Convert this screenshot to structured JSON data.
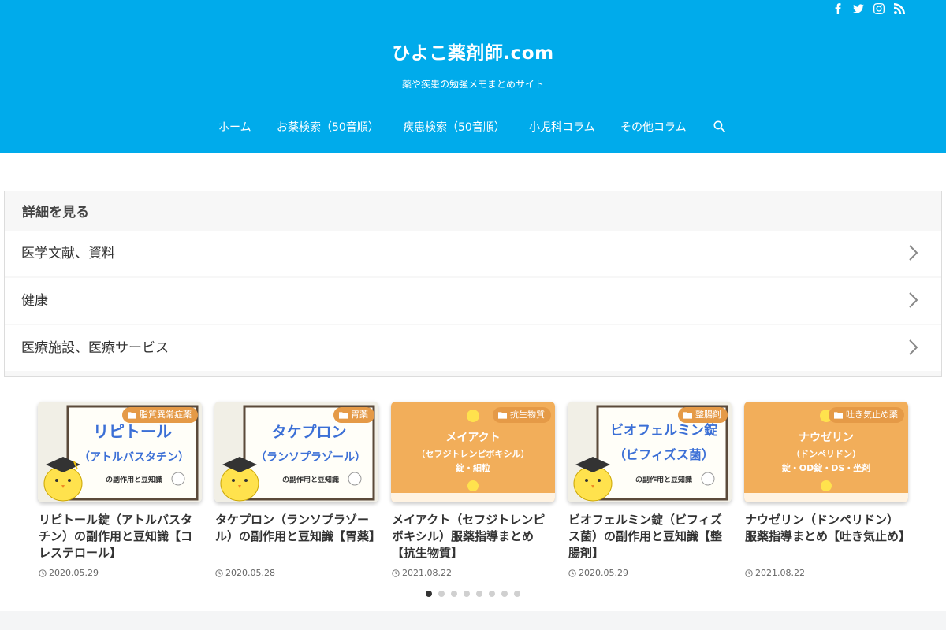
{
  "site": {
    "title": "ひよこ薬剤師.com",
    "description": "薬や疾患の勉強メモまとめサイト",
    "accent_color": "#00abeb",
    "social_icons": [
      "facebook-icon",
      "twitter-icon",
      "instagram-icon",
      "rss-icon"
    ]
  },
  "nav": {
    "items": [
      "ホーム",
      "お薬検索（50音順）",
      "疾患検索（50音順）",
      "小児科コラム",
      "その他コラム"
    ],
    "search_icon": "search-icon"
  },
  "details": {
    "heading": "詳細を見る",
    "items": [
      "医学文献、資料",
      "健康",
      "医療施設、医療サービス"
    ]
  },
  "cards": [
    {
      "category": "脂質異常症薬",
      "thumb_lines": [
        "リピトール",
        "（アトルバスタチン）",
        "の副作用と豆知識"
      ],
      "title": "リピトール錠（アトルバスタチン）の副作用と豆知識【コレステロール】",
      "date": "2020.05.29"
    },
    {
      "category": "胃薬",
      "thumb_lines": [
        "タケプロン",
        "（ランソプラゾール）",
        "の副作用と豆知識"
      ],
      "title": "タケプロン（ランソプラゾール）の副作用と豆知識【胃薬】",
      "date": "2020.05.28"
    },
    {
      "category": "抗生物質",
      "thumb_lines": [
        "メイアクト",
        "（セフジトレンピボキシル）",
        "錠・細粒"
      ],
      "title": "メイアクト（セフジトレンピボキシル）服薬指導まとめ【抗生物質】",
      "date": "2021.08.22"
    },
    {
      "category": "整腸剤",
      "thumb_lines": [
        "ビオフェルミン錠",
        "（ビフィズス菌）",
        "の副作用と豆知識"
      ],
      "title": "ビオフェルミン錠（ビフィズス菌）の副作用と豆知識【整腸剤】",
      "date": "2020.05.29"
    },
    {
      "category": "吐き気止め薬",
      "thumb_lines": [
        "ナウゼリン",
        "（ドンペリドン）",
        "錠・OD錠・DS・坐剤"
      ],
      "title": "ナウゼリン（ドンペリドン）服薬指導まとめ【吐き気止め】",
      "date": "2021.08.22"
    }
  ],
  "carousel": {
    "pages": 8,
    "active": 1
  }
}
